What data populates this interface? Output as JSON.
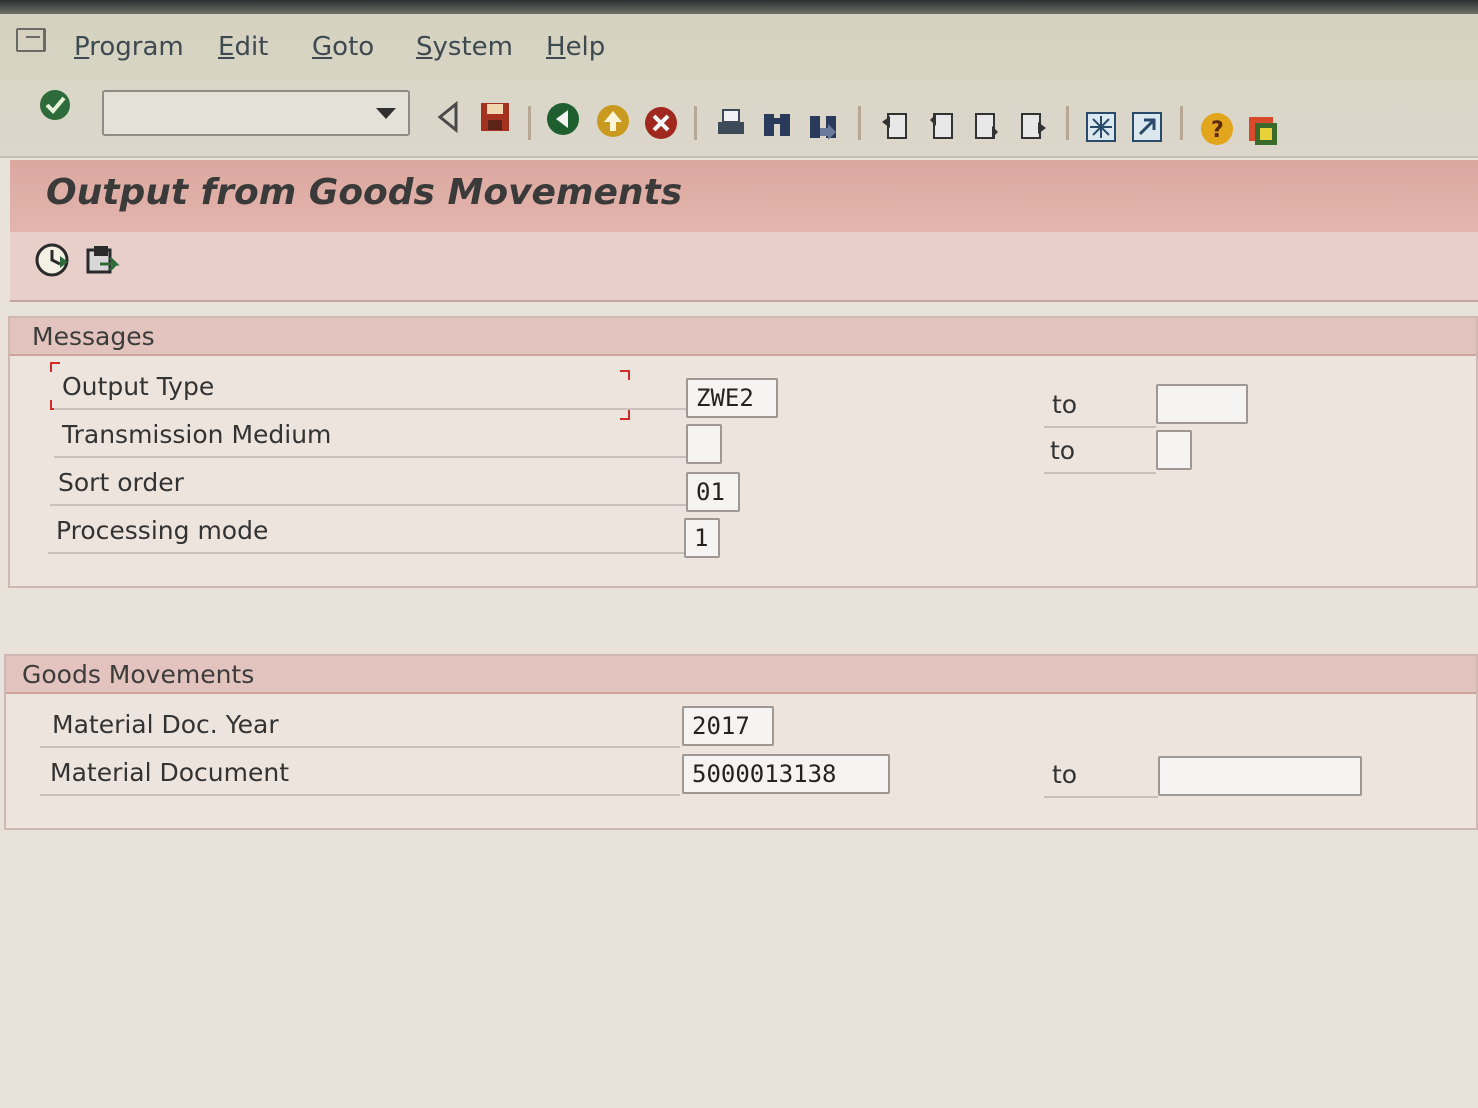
{
  "menu": {
    "items": [
      "Program",
      "Edit",
      "Goto",
      "System",
      "Help"
    ]
  },
  "toolbar": {
    "command_field_value": "",
    "icons": [
      "enter-check-icon",
      "back-arrow-icon",
      "save-icon",
      "back-icon",
      "exit-icon",
      "cancel-icon",
      "print-icon",
      "find-icon",
      "find-next-icon",
      "first-page-icon",
      "previous-page-icon",
      "next-page-icon",
      "last-page-icon",
      "create-session-icon",
      "shortcut-icon",
      "help-icon",
      "layout-icon"
    ]
  },
  "page": {
    "title": "Output from Goods Movements",
    "app_icons": [
      "execute-icon",
      "get-variant-icon"
    ]
  },
  "messages": {
    "header": "Messages",
    "output_type": {
      "label": "Output Type",
      "value": "ZWE2",
      "to_label": "to",
      "to_value": ""
    },
    "transmission_medium": {
      "label": "Transmission Medium",
      "value": "",
      "to_label": "to",
      "to_value": ""
    },
    "sort_order": {
      "label": "Sort order",
      "value": "01"
    },
    "processing_mode": {
      "label": "Processing mode",
      "value": "1"
    }
  },
  "goods_movements": {
    "header": "Goods Movements",
    "material_doc_year": {
      "label": "Material Doc. Year",
      "value": "2017"
    },
    "material_document": {
      "label": "Material Document",
      "value": "5000013138",
      "to_label": "to",
      "to_value": ""
    }
  },
  "colors": {
    "title_bar": "#dba89f",
    "section_header": "#e2c3bd",
    "background": "#e9e2da"
  }
}
